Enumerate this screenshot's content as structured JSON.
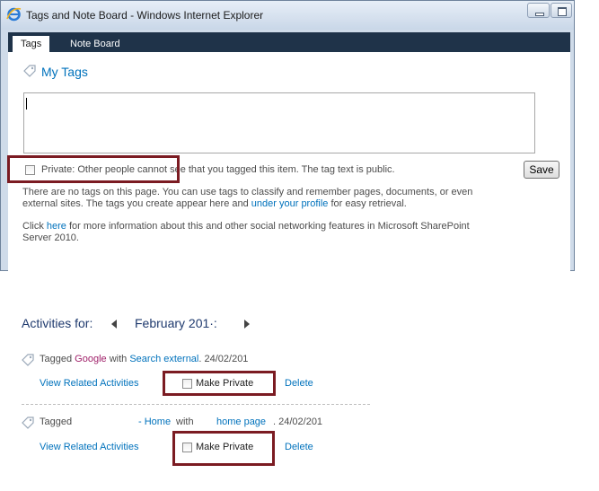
{
  "window": {
    "title": "Tags and Note Board - Windows Internet Explorer"
  },
  "tabs": [
    {
      "label": "Tags",
      "active": true
    },
    {
      "label": "Note Board",
      "active": false
    }
  ],
  "my_tags": {
    "title": "My Tags",
    "input_value": "",
    "private_label": "Private: Other people cannot see that you tagged this item. The tag text is public.",
    "save_label": "Save",
    "no_tags_text_1": "There are no tags on this page. You can use tags to classify and remember pages, documents, or even",
    "no_tags_text_2_pre": "external sites. The tags you create appear here and ",
    "no_tags_link": "under your profile",
    "no_tags_text_2_post": " for easy retrieval.",
    "click_pre": "Click ",
    "click_link": "here",
    "click_post": " for more information about this and other social networking features in Microsoft SharePoint",
    "click_line2": "Server 2010."
  },
  "activities": {
    "title": "Activities for:",
    "month": "February 201·:",
    "items": [
      {
        "tagged": "Tagged ",
        "tag": "Google",
        "with": " with ",
        "target": "Search external",
        "date": ". 24/02/201",
        "view_related": "View Related Activities",
        "make_private": "Make Private",
        "delete": "Delete"
      },
      {
        "tagged": "Tagged",
        "tag": "- Home",
        "with": " with ",
        "target": "home page",
        "date": ". 24/02/201",
        "view_related": "View Related Activities",
        "make_private": "Make Private",
        "delete": "Delete"
      }
    ]
  },
  "colors": {
    "highlight": "#7b1b22",
    "link": "#0072bc",
    "tabbar": "#1f3349"
  }
}
